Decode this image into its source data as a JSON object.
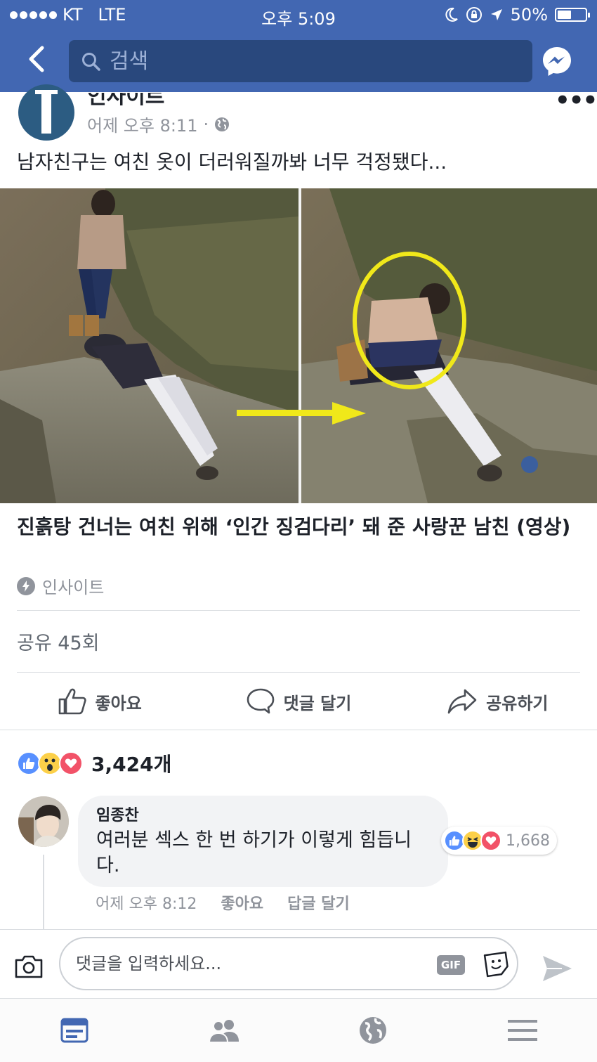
{
  "status_bar": {
    "carrier": "KT",
    "network": "LTE",
    "time": "오후 5:09",
    "battery": "50%"
  },
  "nav": {
    "search_placeholder": "검색"
  },
  "post": {
    "page_name": "인사이트",
    "meta_time": "어제 오후 8:11",
    "meta_separator": "·",
    "text": "남자친구는 여친 옷이 더러워질까봐 너무 걱정됐다...",
    "link_title": "진흙탕 건너는 여친 위해 ‘인간 징검다리’ 돼 준 사랑꾼 남친 (영상)",
    "link_source": "인사이트",
    "share_count": "공유 45회"
  },
  "actions": {
    "like": "좋아요",
    "comment": "댓글 달기",
    "share": "공유하기"
  },
  "reactions": {
    "count": "3,424개"
  },
  "comment": {
    "author": "임종찬",
    "text": "여러분 섹스 한 번 하기가 이렇게 힘듭니다.",
    "reaction_count": "1,668",
    "time": "어제 오후 8:12",
    "like": "좋아요",
    "reply": "답글 달기"
  },
  "composer": {
    "placeholder": "댓글을 입력하세요...",
    "gif_label": "GIF"
  },
  "colors": {
    "brand": "#4267b2",
    "brand_dark": "#29487d",
    "like_blue": "#5890ff",
    "love_red": "#f25268",
    "haha_yellow": "#fcd049",
    "annotation_yellow": "#f0e81a"
  }
}
